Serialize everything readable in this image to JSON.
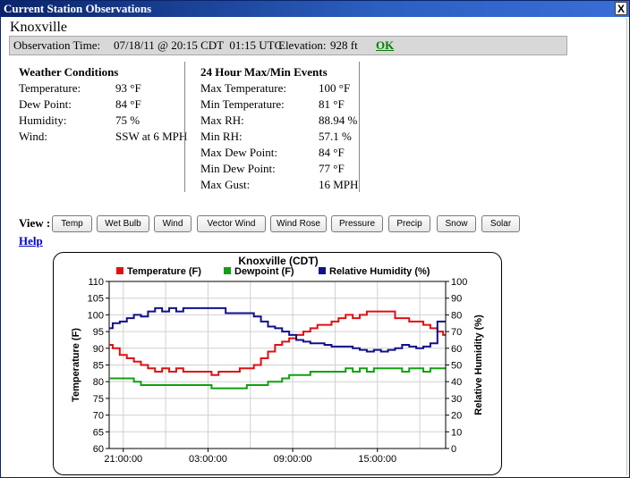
{
  "window": {
    "title": "Current Station Observations",
    "close_label": "X"
  },
  "station": {
    "name": "Knoxville"
  },
  "observation_bar": {
    "time_label": "Observation Time:",
    "time_value": "07/18/11 @ 20:15 CDT  01:15 UTC",
    "elevation_label": "Elevation:",
    "elevation_value": "928 ft",
    "ok_label": "OK"
  },
  "weather_conditions": {
    "title": "Weather Conditions",
    "rows": [
      {
        "label": "Temperature:",
        "value": "93 °F"
      },
      {
        "label": "Dew Point:",
        "value": "84 °F"
      },
      {
        "label": "Humidity:",
        "value": "75 %"
      },
      {
        "label": "Wind:",
        "value": "SSW at 6 MPH"
      }
    ]
  },
  "max_min_events": {
    "title": "24 Hour Max/Min Events",
    "rows": [
      {
        "label": "Max Temperature:",
        "value": "100 °F"
      },
      {
        "label": "Min Temperature:",
        "value": "81 °F"
      },
      {
        "label": "Max RH:",
        "value": "88.94 %"
      },
      {
        "label": "Min RH:",
        "value": "57.1 %"
      },
      {
        "label": "Max Dew Point:",
        "value": "84 °F"
      },
      {
        "label": "Min Dew Point:",
        "value": "77 °F"
      },
      {
        "label": "Max Gust:",
        "value": "16 MPH"
      }
    ]
  },
  "view": {
    "label": "View :",
    "buttons": [
      "Temp",
      "Wet Bulb",
      "Wind",
      "Vector Wind",
      "Wind Rose",
      "Pressure",
      "Precip",
      "Snow",
      "Solar"
    ],
    "help_label": "Help"
  },
  "chart_data": {
    "type": "line",
    "title": "Knoxville (CDT)",
    "xlabel": "",
    "ylabel": "Temperature (F)",
    "y2label": "Relative Humidity (%)",
    "xlim": [
      "20:00",
      "19:50"
    ],
    "x_ticks": [
      "21:00:00",
      "03:00:00",
      "09:00:00",
      "15:00:00"
    ],
    "ylim": [
      60,
      110
    ],
    "y_ticks": [
      60,
      65,
      70,
      75,
      80,
      85,
      90,
      95,
      100,
      105,
      110
    ],
    "y2lim": [
      0,
      100
    ],
    "y2_ticks": [
      0,
      10,
      20,
      30,
      40,
      50,
      60,
      70,
      80,
      90,
      100
    ],
    "grid": true,
    "legend": "top",
    "x_hours": [
      0,
      0.5,
      1,
      1.5,
      2,
      2.5,
      3,
      3.5,
      4,
      4.5,
      5,
      5.5,
      6,
      6.5,
      7,
      7.5,
      8,
      8.5,
      9,
      9.5,
      10,
      10.5,
      11,
      11.5,
      12,
      12.5,
      13,
      13.5,
      14,
      14.5,
      15,
      15.5,
      16,
      16.5,
      17,
      17.5,
      18,
      18.5,
      19,
      19.5,
      20,
      20.5,
      21,
      21.5,
      22,
      22.5,
      23,
      23.5,
      23.8
    ],
    "series": [
      {
        "name": "Temperature (F)",
        "color": "#e01010",
        "axis": "left",
        "values": [
          91,
          90,
          88,
          87,
          86,
          85,
          84,
          83,
          84,
          83,
          84,
          83,
          83,
          83,
          83,
          82,
          83,
          83,
          83,
          84,
          84,
          85,
          87,
          89,
          91,
          92,
          93,
          94,
          95,
          96,
          97,
          97,
          98,
          99,
          100,
          99,
          100,
          101,
          101,
          101,
          101,
          99,
          99,
          98,
          98,
          97,
          96,
          95,
          94
        ]
      },
      {
        "name": "Dewpoint (F)",
        "color": "#10a010",
        "axis": "left",
        "values": [
          81,
          81,
          81,
          81,
          80,
          79,
          79,
          79,
          79,
          79,
          79,
          79,
          79,
          79,
          79,
          78,
          78,
          78,
          78,
          78,
          79,
          79,
          79,
          80,
          80,
          81,
          82,
          82,
          82,
          83,
          83,
          83,
          83,
          83,
          84,
          83,
          84,
          83,
          84,
          84,
          84,
          84,
          83,
          84,
          84,
          83,
          84,
          84,
          84
        ]
      },
      {
        "name": "Relative Humidity (%)",
        "color": "#10108c",
        "axis": "right",
        "values": [
          72,
          75,
          76,
          78,
          80,
          79,
          82,
          84,
          82,
          84,
          82,
          84,
          84,
          84,
          84,
          84,
          84,
          81,
          81,
          81,
          81,
          79,
          76,
          73,
          72,
          70,
          68,
          65,
          64,
          63,
          63,
          62,
          61,
          61,
          61,
          60,
          59,
          58,
          59,
          58,
          59,
          60,
          62,
          61,
          60,
          61,
          63,
          76,
          76
        ]
      }
    ]
  }
}
